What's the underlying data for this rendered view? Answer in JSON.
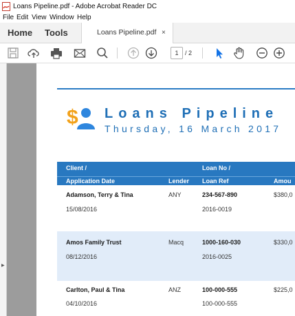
{
  "window": {
    "title": "Loans Pipeline.pdf - Adobe Acrobat Reader DC"
  },
  "menu": [
    "File",
    "Edit",
    "View",
    "Window",
    "Help"
  ],
  "tabs": {
    "home": "Home",
    "tools": "Tools",
    "document": "Loans Pipeline.pdf",
    "close": "×"
  },
  "toolbar": {
    "icons": [
      "save-icon",
      "upload-cloud-icon",
      "print-icon",
      "email-icon",
      "search-icon",
      "page-up-icon",
      "page-down-icon",
      "select-arrow-icon",
      "hand-tool-icon",
      "zoom-out-icon",
      "zoom-in-icon"
    ],
    "page_current": "1",
    "page_total": "/ 2"
  },
  "report": {
    "title": "Loans Pipeline",
    "date": "Thursday, 16 March 2017",
    "accent": "#1f6fb6"
  },
  "table": {
    "header_bg": "#2878c0",
    "columns": {
      "client": "Client /",
      "application_date": "Application Date",
      "lender": "Lender",
      "loan_no": "Loan No /",
      "loan_ref": "Loan Ref",
      "amount": "Amou"
    },
    "rows": [
      {
        "client": "Adamson, Terry & Tina",
        "date": "15/08/2016",
        "lender": "ANY",
        "loan_no": "234-567-890",
        "loan_ref": "2016-0019",
        "amount": "$380,0"
      },
      {
        "client": "Amos Family Trust",
        "date": "08/12/2016",
        "lender": "Macq",
        "loan_no": "1000-160-030",
        "loan_ref": "2016-0025",
        "amount": "$330,0"
      },
      {
        "client": "Carlton, Paul & Tina",
        "date": "04/10/2016",
        "lender": "ANZ",
        "loan_no": "100-000-555",
        "loan_ref": "100-000-555",
        "amount": "$225,0"
      }
    ]
  }
}
